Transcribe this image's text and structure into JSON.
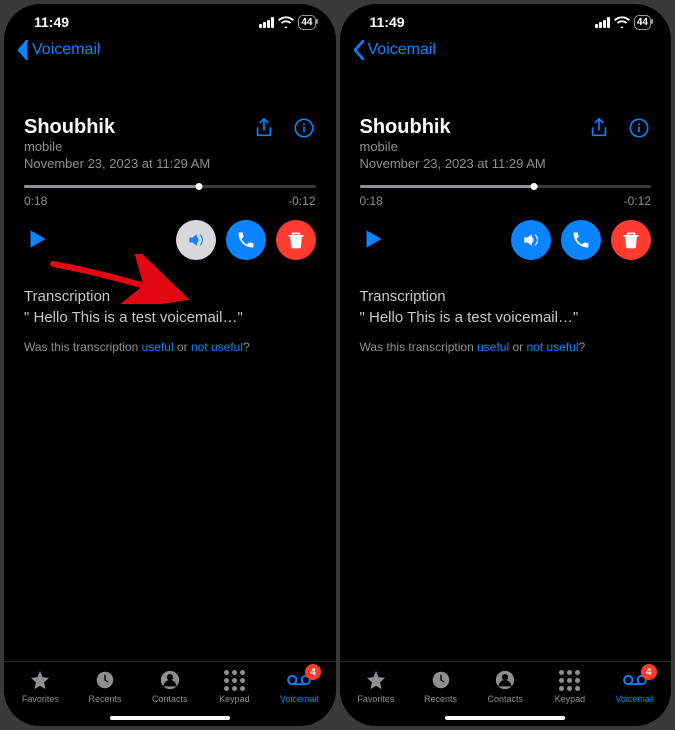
{
  "status": {
    "time": "11:49",
    "battery_text": "44"
  },
  "nav": {
    "back_label": "Voicemail"
  },
  "voicemail": {
    "caller": "Shoubhik",
    "type": "mobile",
    "date": "November 23, 2023 at 11:29 AM",
    "elapsed": "0:18",
    "remaining": "-0:12",
    "progress_percent": 60
  },
  "transcription": {
    "title": "Transcription",
    "text": "\" Hello This is a test voicemail…\"",
    "feedback_pre": "Was this transcription ",
    "useful": "useful",
    "or": " or ",
    "not_useful": "not useful",
    "q": "?"
  },
  "tabs": {
    "favorites": "Favorites",
    "recents": "Recents",
    "contacts": "Contacts",
    "keypad": "Keypad",
    "voicemail": "Voicemail",
    "badge": "4"
  },
  "colors": {
    "accent": "#0a84ff",
    "danger": "#ff3b30"
  },
  "left_variant": {
    "speaker_active_bg": "#d8d8dc",
    "arrow": true
  },
  "right_variant": {
    "speaker_active_bg": "#0a84ff",
    "arrow": false
  }
}
